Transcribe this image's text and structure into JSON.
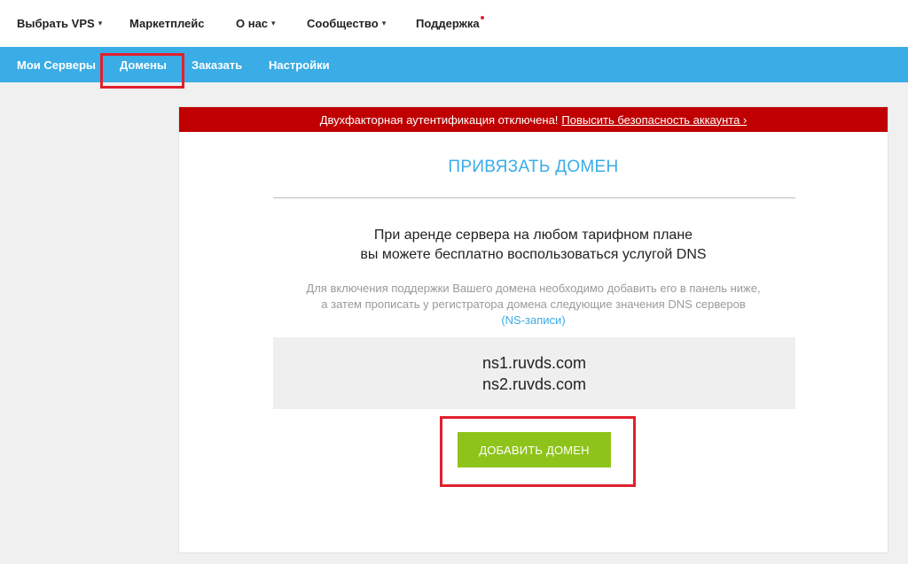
{
  "topnav": {
    "items": [
      {
        "label": "Выбрать VPS",
        "caret": "▾"
      },
      {
        "label": "Маркетплейс"
      },
      {
        "label": "О нас",
        "caret": "▾"
      },
      {
        "label": "Сообщество",
        "caret": "▾"
      },
      {
        "label": "Поддержка"
      }
    ]
  },
  "subnav": {
    "items": [
      {
        "label": "Мои Серверы"
      },
      {
        "label": "Домены"
      },
      {
        "label": "Заказать"
      },
      {
        "label": "Настройки"
      }
    ]
  },
  "alert": {
    "text": "Двухфакторная аутентификация отключена!",
    "link": "Повысить безопасность аккаунта ›"
  },
  "main": {
    "title": "ПРИВЯЗАТЬ ДОМЕН",
    "lead_line1": "При аренде сервера на любом тарифном плане",
    "lead_line2": "вы можете бесплатно воспользоваться услугой DNS",
    "info_line1": "Для включения поддержки Вашего домена необходимо добавить его в панель ниже,",
    "info_line2": "а затем прописать у регистратора домена следующие значения DNS серверов",
    "info_link": "(NS-записи)",
    "ns1": "ns1.ruvds.com",
    "ns2": "ns2.ruvds.com",
    "add_button": "ДОБАВИТЬ ДОМЕН"
  },
  "colors": {
    "accent": "#3aace6",
    "alert": "#c00000",
    "button": "#8ec31b",
    "highlight": "#e0202e"
  }
}
